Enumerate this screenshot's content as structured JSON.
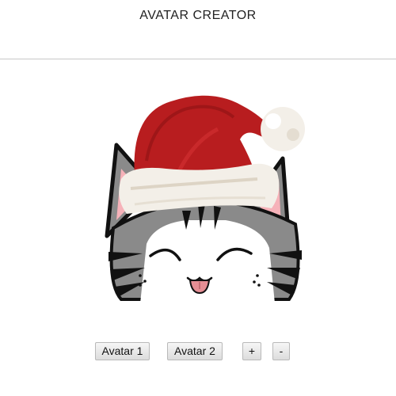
{
  "app": {
    "title": "AVATAR CREATOR"
  },
  "avatar": {
    "character": "cat-face",
    "accessory": "santa-hat"
  },
  "controls": {
    "avatar1_label": "Avatar 1",
    "avatar2_label": "Avatar 2",
    "zoom_in_label": "+",
    "zoom_out_label": "-"
  },
  "colors": {
    "hat_red": "#b81d1f",
    "fur_white": "#f3efe8",
    "cat_gray": "#8a8a8a",
    "outline": "#111111",
    "tongue": "#e58e94"
  }
}
